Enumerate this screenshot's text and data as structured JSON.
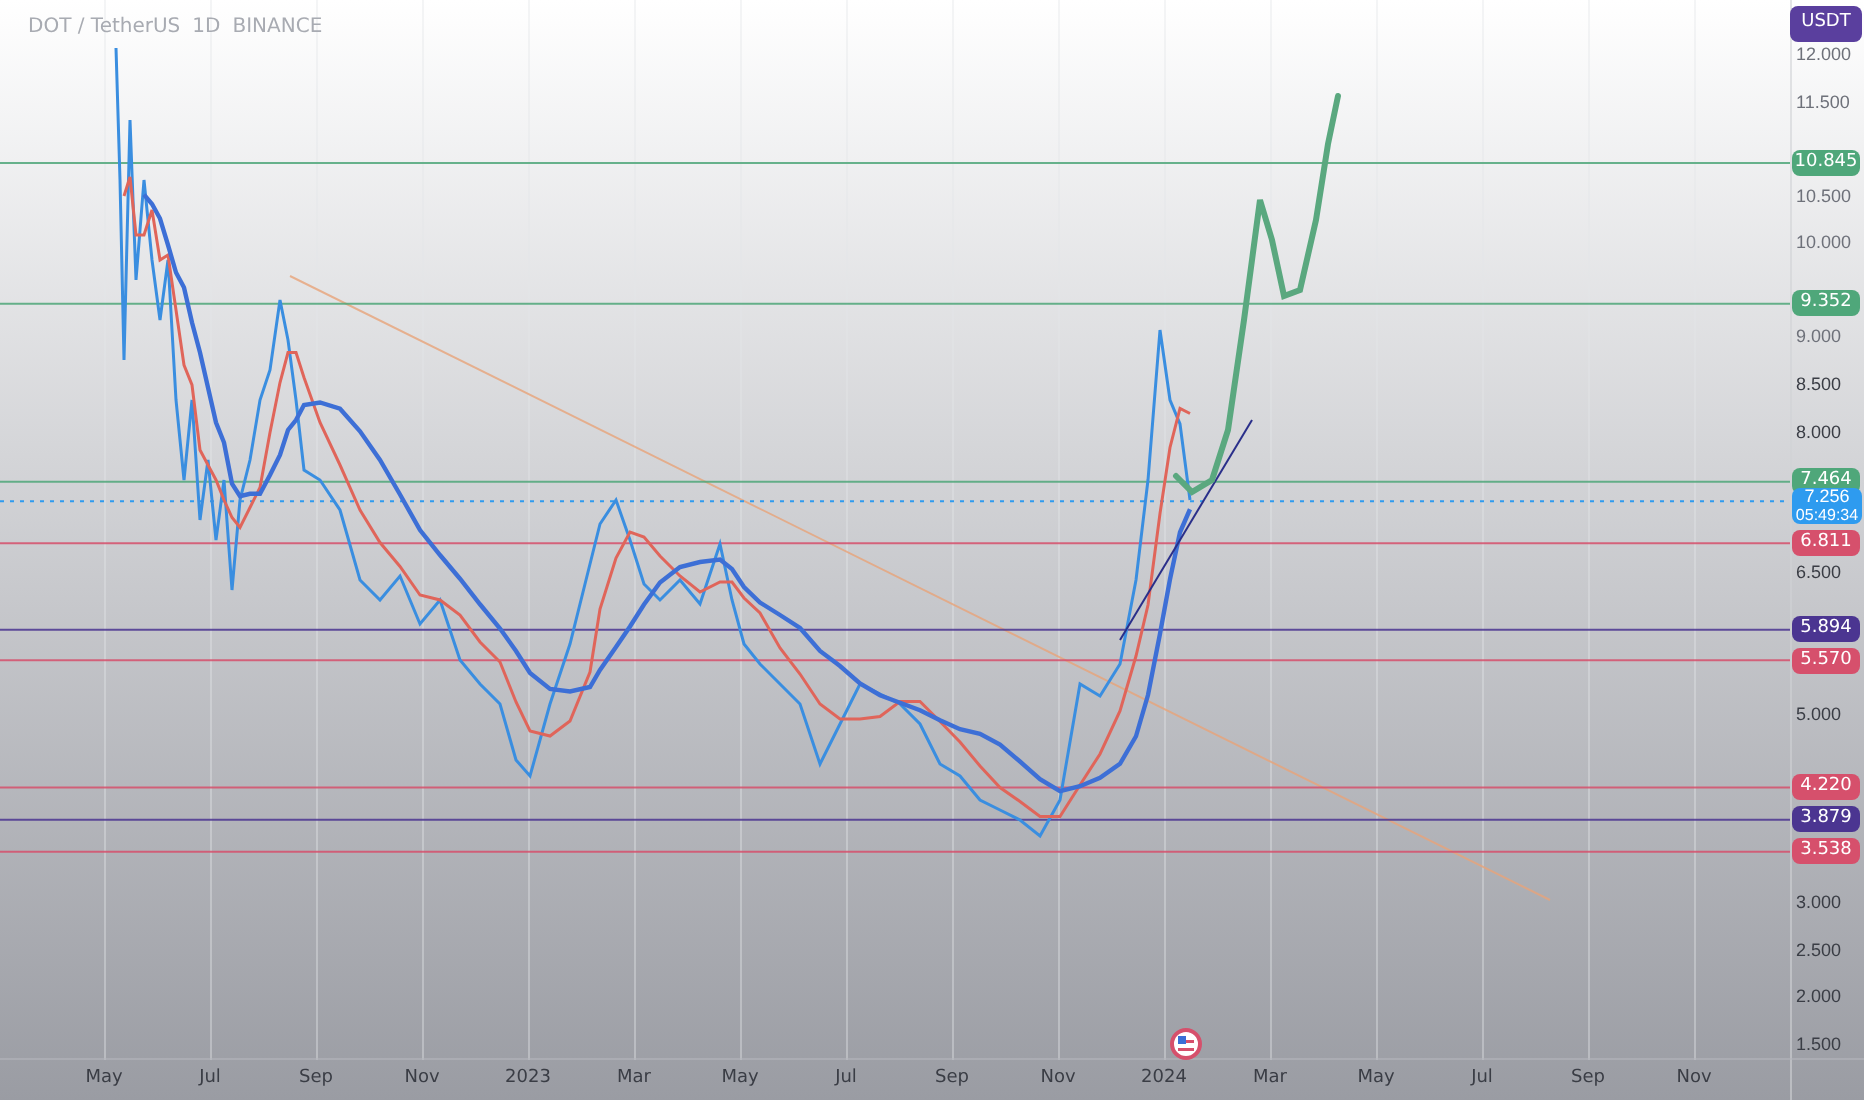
{
  "header": {
    "symbol": "DOT / TetherUS",
    "interval": "1D",
    "exchange": "BINANCE"
  },
  "currency": "USDT",
  "price_axis": [
    "12.000",
    "11.500",
    "10.500",
    "10.000",
    "9.000",
    "8.500",
    "8.000",
    "6.500",
    "5.000",
    "3.000",
    "2.500",
    "2.000",
    "1.500"
  ],
  "time_axis": [
    "May",
    "Jul",
    "Sep",
    "Nov",
    "2023",
    "Mar",
    "May",
    "Jul",
    "Sep",
    "Nov",
    "2024",
    "Mar",
    "May",
    "Jul",
    "Sep",
    "Nov"
  ],
  "levels": [
    {
      "price": "10.845",
      "color": "#4fa77a"
    },
    {
      "price": "9.352",
      "color": "#4fa77a"
    },
    {
      "price": "7.464",
      "color": "#4fa77a"
    },
    {
      "price": "6.811",
      "color": "#d6506c"
    },
    {
      "price": "5.894",
      "color": "#4b3591"
    },
    {
      "price": "5.570",
      "color": "#d6506c"
    },
    {
      "price": "4.220",
      "color": "#d6506c"
    },
    {
      "price": "3.879",
      "color": "#4b3591"
    },
    {
      "price": "3.538",
      "color": "#d6506c"
    }
  ],
  "last_price": {
    "price": "7.256",
    "countdown": "05:49:34"
  }
}
